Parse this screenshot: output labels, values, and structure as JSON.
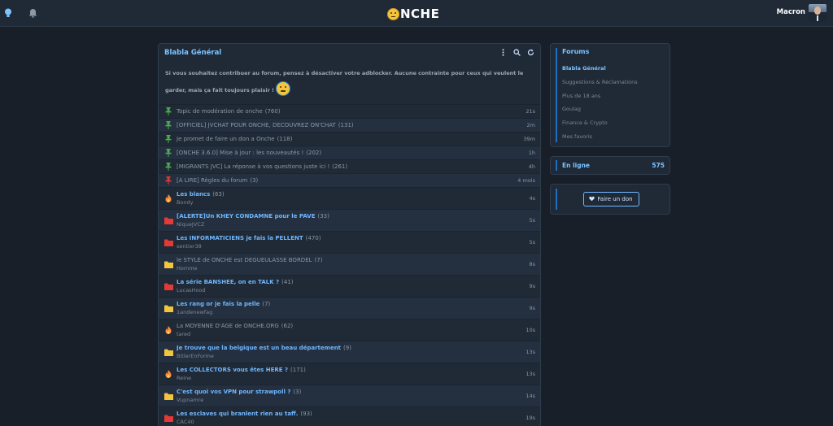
{
  "topbar": {
    "logo_text": "NCHE",
    "user_name": "Macron"
  },
  "main": {
    "title": "Blabla Général",
    "notice": "Si vous souhaitez contribuer au forum, pensez à désactiver votre adblocker. Aucune contrainte pour ceux qui veulent le garder, mais ça fait toujours plaisir !",
    "topics": [
      {
        "kind": "pinned",
        "icon": "pin-green-icon",
        "title": "Topic de modération de onche",
        "count": "(760)",
        "author": "",
        "time": "21s"
      },
      {
        "kind": "pinned",
        "icon": "pin-green-icon",
        "title": "[OFFICIEL] JVCHAT POUR ONCHE, DECOUVREZ ON'CHAT",
        "count": "(131)",
        "author": "",
        "time": "2m"
      },
      {
        "kind": "pinned",
        "icon": "pin-green-icon",
        "title": "Je promet de faire un don a Onche",
        "count": "(118)",
        "author": "",
        "time": "39m"
      },
      {
        "kind": "pinned",
        "icon": "pin-green-icon",
        "title": "[ONCHE 3.6.0] Mise à jour : les nouveautés !",
        "count": "(202)",
        "author": "",
        "time": "1h"
      },
      {
        "kind": "pinned",
        "icon": "pin-green-icon",
        "title": "[MIGRANTS JVC] La réponse à vos questions juste ici !",
        "count": "(261)",
        "author": "",
        "time": "4h"
      },
      {
        "kind": "pinned",
        "icon": "pin-red-icon",
        "title": "[À LIRE] Règles du forum",
        "count": "(3)",
        "author": "",
        "time": "4 mois"
      },
      {
        "kind": "hot",
        "icon": "flame-icon",
        "title": "Les blancs",
        "count": "(63)",
        "author": "Bondy",
        "time": "4s"
      },
      {
        "kind": "hot",
        "icon": "folder-red-icon",
        "title": "[ALERTE]Un KHEY CONDAMNE pour le PAVE",
        "count": "(33)",
        "author": "NiqueJVCZ",
        "time": "5s"
      },
      {
        "kind": "hot",
        "icon": "folder-red-icon",
        "title": "Les INFORMATICIENS je fais la PELLENT",
        "count": "(470)",
        "author": "sentier38",
        "time": "5s"
      },
      {
        "kind": "normal",
        "icon": "folder-yellow-icon",
        "title": "le STYLE de ONCHE est DEGUEULASSE BORDEL",
        "count": "(7)",
        "author": "Homme",
        "time": "8s"
      },
      {
        "kind": "hot",
        "icon": "folder-red-icon",
        "title": "La série BANSHEE, on en TALK ?",
        "count": "(41)",
        "author": "LucasHood",
        "time": "9s"
      },
      {
        "kind": "hot",
        "icon": "folder-yellow-icon",
        "title": "Les rang or je fais la pelle",
        "count": "(7)",
        "author": "1andenewfag",
        "time": "9s"
      },
      {
        "kind": "normal",
        "icon": "flame-icon",
        "title": "La MOYENNE D'ÂGE de ONCHE.ORG",
        "count": "(62)",
        "author": "tared",
        "time": "10s"
      },
      {
        "kind": "hot",
        "icon": "folder-yellow-icon",
        "title": "Je trouve que la belgique est un beau département",
        "count": "(9)",
        "author": "BitlerEnForme",
        "time": "13s"
      },
      {
        "kind": "hot",
        "icon": "flame-icon",
        "title": "Les COLLECTORS vous êtes HERE ?",
        "count": "(171)",
        "author": "Reine",
        "time": "13s"
      },
      {
        "kind": "hot",
        "icon": "folder-yellow-icon",
        "title": "C'est quoi vos VPN pour strawpoll ?",
        "count": "(3)",
        "author": "Vupnamre",
        "time": "14s"
      },
      {
        "kind": "hot",
        "icon": "folder-red-icon",
        "title": "Les esclaves qui branlent rien au taff.",
        "count": "(93)",
        "author": "CAC40",
        "time": "19s"
      }
    ]
  },
  "sidebar": {
    "forums_title": "Forums",
    "forums": [
      "Blabla Général",
      "Suggestions & Réclamations",
      "Plus de 18 ans",
      "Goulag",
      "Finance & Crypto",
      "Mes favoris"
    ],
    "online_label": "En ligne",
    "online_count": "575",
    "don_label": "Faire un don"
  },
  "colors": {
    "background": "#181f29",
    "panel": "#202a37",
    "accent": "#6fb7ff",
    "pin_green": "#4caf50",
    "pin_red": "#e53935",
    "folder_red": "#e53935",
    "folder_yellow": "#f2c53d",
    "flame": "#ff8a3d"
  }
}
